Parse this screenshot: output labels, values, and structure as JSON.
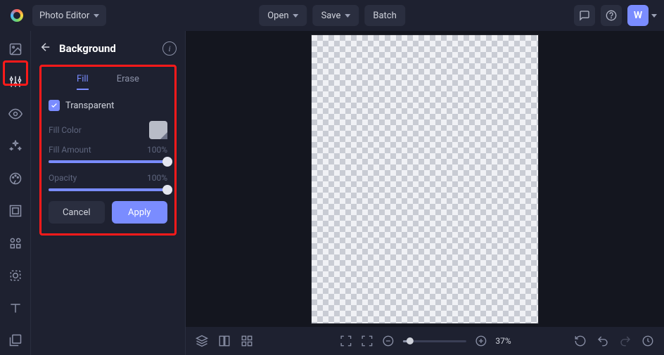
{
  "header": {
    "app_label": "Photo Editor",
    "open_label": "Open",
    "save_label": "Save",
    "batch_label": "Batch",
    "avatar_initial": "W"
  },
  "panel": {
    "title": "Background",
    "tabs": {
      "fill": "Fill",
      "erase": "Erase"
    },
    "transparent_label": "Transparent",
    "fill_color_label": "Fill Color",
    "fill_amount_label": "Fill Amount",
    "fill_amount_value": "100%",
    "opacity_label": "Opacity",
    "opacity_value": "100%",
    "cancel_label": "Cancel",
    "apply_label": "Apply"
  },
  "footer": {
    "zoom_value": "37%"
  },
  "colors": {
    "accent": "#7a8cff",
    "highlight": "#ff1a1a"
  }
}
